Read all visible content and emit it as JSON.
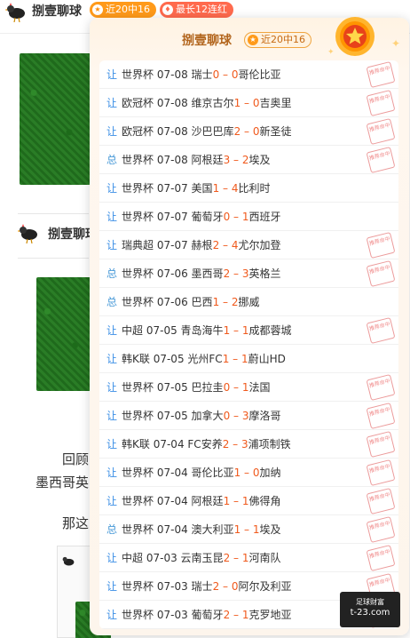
{
  "header": {
    "author": "捌壹聊球",
    "recent_badge": "近20中16",
    "streak_badge": "最长12连红"
  },
  "article": {
    "author_repeat": "捌壹聊球",
    "partial_text_1": "回顾",
    "partial_text_2": "墨西哥英",
    "partial_text_3": "那这"
  },
  "popup": {
    "title": "捌壹聊球",
    "badge": "近20中16",
    "stamp_text": "推荐命中",
    "rows": [
      {
        "type": "让",
        "league": "世界杯",
        "date": "07-08",
        "home": "瑞士",
        "hs": "0",
        "as": "0",
        "away": "哥伦比亚",
        "hit": true
      },
      {
        "type": "让",
        "league": "欧冠杯",
        "date": "07-08",
        "home": "维京古尔",
        "hs": "1",
        "as": "0",
        "away": "吉奥里",
        "hit": true
      },
      {
        "type": "让",
        "league": "欧冠杯",
        "date": "07-08",
        "home": "沙巴巴库",
        "hs": "2",
        "as": "0",
        "away": "新圣徒",
        "hit": true
      },
      {
        "type": "总",
        "league": "世界杯",
        "date": "07-08",
        "home": "阿根廷",
        "hs": "3",
        "as": "2",
        "away": "埃及",
        "hit": true
      },
      {
        "type": "让",
        "league": "世界杯",
        "date": "07-07",
        "home": "美国",
        "hs": "1",
        "as": "4",
        "away": "比利时",
        "hit": false
      },
      {
        "type": "让",
        "league": "世界杯",
        "date": "07-07",
        "home": "葡萄牙",
        "hs": "0",
        "as": "1",
        "away": "西班牙",
        "hit": false
      },
      {
        "type": "让",
        "league": "瑞典超",
        "date": "07-07",
        "home": "赫根",
        "hs": "2",
        "as": "4",
        "away": "尤尔加登",
        "hit": true
      },
      {
        "type": "总",
        "league": "世界杯",
        "date": "07-06",
        "home": "墨西哥",
        "hs": "2",
        "as": "3",
        "away": "英格兰",
        "hit": true
      },
      {
        "type": "总",
        "league": "世界杯",
        "date": "07-06",
        "home": "巴西",
        "hs": "1",
        "as": "2",
        "away": "挪威",
        "hit": false
      },
      {
        "type": "让",
        "league": "中超",
        "date": "07-05",
        "home": "青岛海牛",
        "hs": "1",
        "as": "1",
        "away": "成都蓉城",
        "hit": true
      },
      {
        "type": "让",
        "league": "韩K联",
        "date": "07-05",
        "home": "光州FC",
        "hs": "1",
        "as": "1",
        "away": "蔚山HD",
        "hit": false
      },
      {
        "type": "让",
        "league": "世界杯",
        "date": "07-05",
        "home": "巴拉圭",
        "hs": "0",
        "as": "1",
        "away": "法国",
        "hit": true
      },
      {
        "type": "让",
        "league": "世界杯",
        "date": "07-05",
        "home": "加拿大",
        "hs": "0",
        "as": "3",
        "away": "摩洛哥",
        "hit": true
      },
      {
        "type": "让",
        "league": "韩K联",
        "date": "07-04",
        "home": "FC安养",
        "hs": "2",
        "as": "3",
        "away": "浦项制铁",
        "hit": true
      },
      {
        "type": "让",
        "league": "世界杯",
        "date": "07-04",
        "home": "哥伦比亚",
        "hs": "1",
        "as": "0",
        "away": "加纳",
        "hit": true
      },
      {
        "type": "让",
        "league": "世界杯",
        "date": "07-04",
        "home": "阿根廷",
        "hs": "1",
        "as": "1",
        "away": "佛得角",
        "hit": true
      },
      {
        "type": "总",
        "league": "世界杯",
        "date": "07-04",
        "home": "澳大利亚",
        "hs": "1",
        "as": "1",
        "away": "埃及",
        "hit": true
      },
      {
        "type": "让",
        "league": "中超",
        "date": "07-03",
        "home": "云南玉昆",
        "hs": "2",
        "as": "1",
        "away": "河南队",
        "hit": true
      },
      {
        "type": "让",
        "league": "世界杯",
        "date": "07-03",
        "home": "瑞士",
        "hs": "2",
        "as": "0",
        "away": "阿尔及利亚",
        "hit": true
      },
      {
        "type": "让",
        "league": "世界杯",
        "date": "07-03",
        "home": "葡萄牙",
        "hs": "2",
        "as": "1",
        "away": "克罗地亚",
        "hit": true
      }
    ]
  },
  "watermark": {
    "line1": "足球财富",
    "line2": "t-23.com"
  },
  "colors": {
    "accent_orange": "#ff9a1a",
    "score_red": "#f05a1d",
    "type_blue": "#3a8ee6",
    "stamp_red": "#e77777"
  }
}
